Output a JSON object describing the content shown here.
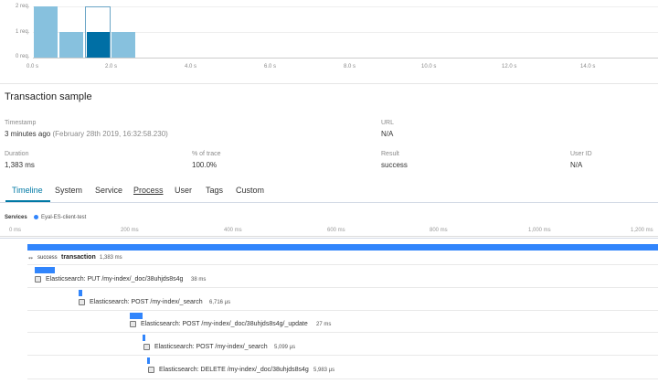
{
  "histogram": {
    "y_labels": [
      "2 req.",
      "1 req.",
      "0 req."
    ],
    "x_labels": [
      "0.0 s",
      "2.0 s",
      "4.0 s",
      "6.0 s",
      "8.0 s",
      "10.0 s",
      "12.0 s",
      "14.0 s"
    ],
    "colors": {
      "bar": "#87c1de",
      "selected": "#006fa5",
      "hover_outline": "#6aa5c6"
    }
  },
  "transaction": {
    "title": "Transaction sample",
    "timestamp_label": "Timestamp",
    "timestamp_value": "3 minutes ago",
    "timestamp_detail": "(February 28th 2019, 16:32:58.230)",
    "url_label": "URL",
    "url_value": "N/A",
    "duration_label": "Duration",
    "duration_value": "1,383 ms",
    "pct_label": "% of trace",
    "pct_value": "100.0%",
    "result_label": "Result",
    "result_value": "success",
    "userid_label": "User ID",
    "userid_value": "N/A"
  },
  "tabs": [
    {
      "label": "Timeline"
    },
    {
      "label": "System"
    },
    {
      "label": "Service"
    },
    {
      "label": "Process"
    },
    {
      "label": "User"
    },
    {
      "label": "Tags"
    },
    {
      "label": "Custom"
    }
  ],
  "services": {
    "label": "Services",
    "service_name": "Eyal-ES-client-test",
    "service_color": "#3185fc"
  },
  "time_axis": [
    "0 ms",
    "200 ms",
    "400 ms",
    "600 ms",
    "800 ms",
    "1,000 ms",
    "1,200 ms"
  ],
  "waterfall": {
    "transaction": {
      "result": "success",
      "name": "transaction",
      "duration": "1,383 ms"
    },
    "spans": [
      {
        "name": "Elasticsearch: PUT /my-index/_doc/38uhjds8s4g",
        "duration": "38 ms"
      },
      {
        "name": "Elasticsearch: POST /my-index/_search",
        "duration": "6,716 µs"
      },
      {
        "name": "Elasticsearch: POST /my-index/_doc/38uhjds8s4g/_update",
        "duration": "27 ms"
      },
      {
        "name": "Elasticsearch: POST /my-index/_search",
        "duration": "5,099 µs"
      },
      {
        "name": "Elasticsearch: DELETE /my-index/_doc/38uhjds8s4g",
        "duration": "5,983 µs"
      }
    ],
    "bar_color": "#3185fc"
  }
}
